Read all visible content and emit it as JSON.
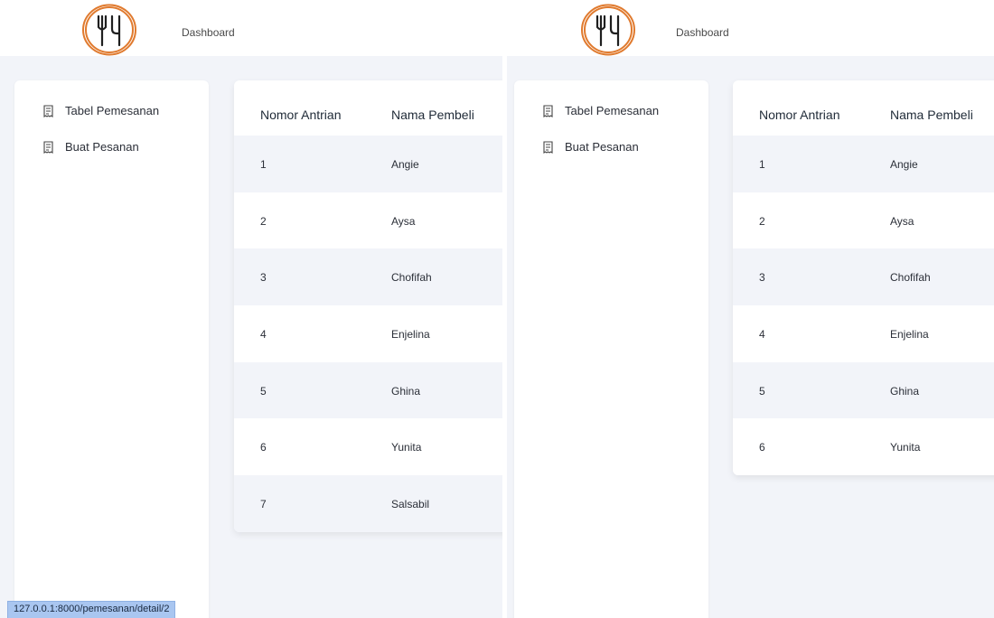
{
  "nav": {
    "dashboard": "Dashboard"
  },
  "logo": {
    "accent": "#e07a2e",
    "icon": "fork-knife-logo"
  },
  "sidebar": {
    "items": [
      {
        "label": "Tabel Pemesanan",
        "icon": "receipt-icon"
      },
      {
        "label": "Buat Pesanan",
        "icon": "receipt-icon"
      }
    ]
  },
  "table": {
    "headers": [
      "Nomor Antrian",
      "Nama Pembeli"
    ],
    "left_rows": [
      [
        "1",
        "Angie"
      ],
      [
        "2",
        "Aysa"
      ],
      [
        "3",
        "Chofifah"
      ],
      [
        "4",
        "Enjelina"
      ],
      [
        "5",
        "Ghina"
      ],
      [
        "6",
        "Yunita"
      ],
      [
        "7",
        "Salsabil"
      ]
    ],
    "right_rows": [
      [
        "1",
        "Angie"
      ],
      [
        "2",
        "Aysa"
      ],
      [
        "3",
        "Chofifah"
      ],
      [
        "4",
        "Enjelina"
      ],
      [
        "5",
        "Ghina"
      ],
      [
        "6",
        "Yunita"
      ]
    ]
  },
  "status": {
    "url": "127.0.0.1:8000/pemesanan/detail/2"
  }
}
